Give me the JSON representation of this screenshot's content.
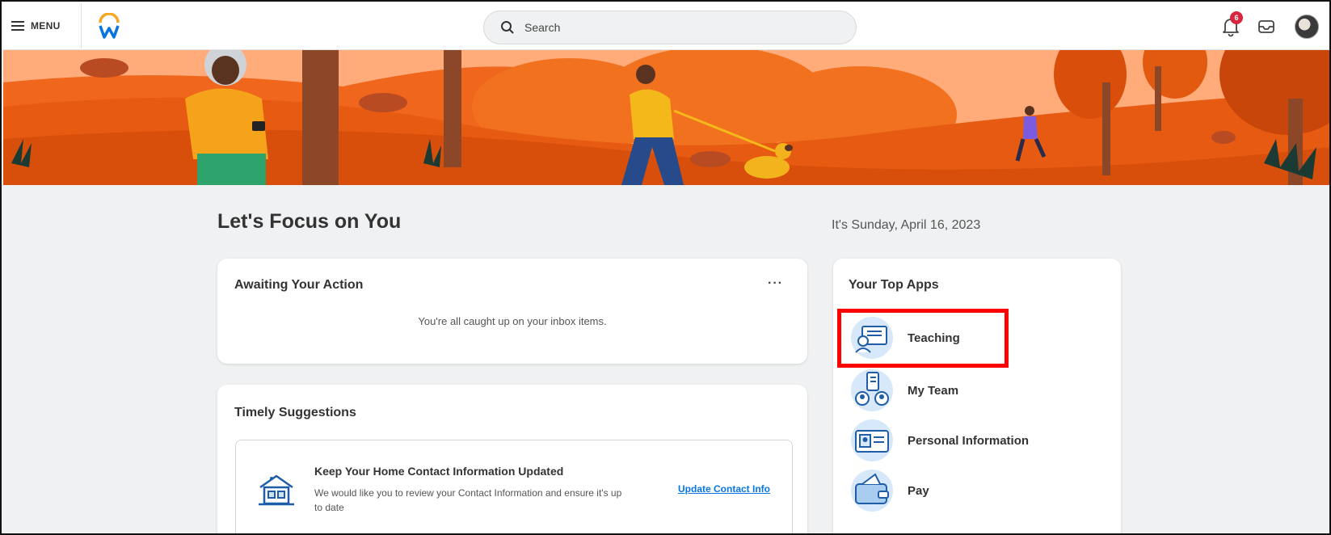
{
  "header": {
    "menu_label": "MENU",
    "search_placeholder": "Search",
    "notification_count": "6"
  },
  "main": {
    "title": "Let's Focus on You",
    "date": "It's Sunday, April 16, 2023"
  },
  "awaiting": {
    "title": "Awaiting Your Action",
    "more": "···",
    "empty_message": "You're all caught up on your inbox items."
  },
  "timely": {
    "title": "Timely Suggestions",
    "suggestion": {
      "title": "Keep Your Home Contact Information Updated",
      "description": "We would like you to review your Contact Information and ensure it's up to date",
      "action": "Update Contact Info"
    }
  },
  "top_apps": {
    "title": "Your Top Apps",
    "items": [
      {
        "label": "Teaching",
        "icon": "teaching-icon"
      },
      {
        "label": "My Team",
        "icon": "my-team-icon"
      },
      {
        "label": "Personal Information",
        "icon": "personal-information-icon"
      },
      {
        "label": "Pay",
        "icon": "pay-icon"
      }
    ]
  },
  "colors": {
    "banner_dark": "#e0530f",
    "banner_mid": "#f46a1e",
    "banner_light": "#ffab7a",
    "link": "#0875e1",
    "highlight": "#ff0000"
  }
}
